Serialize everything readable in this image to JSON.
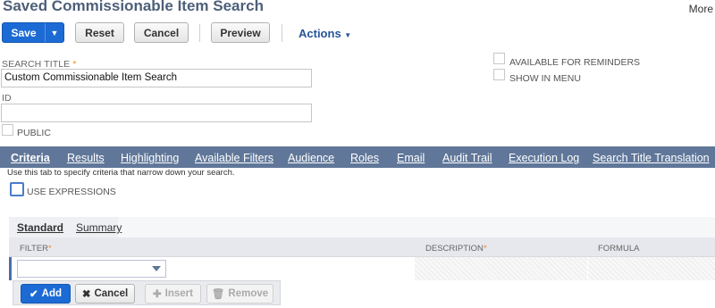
{
  "header": {
    "title": "Saved Commissionable Item Search",
    "more_label": "More"
  },
  "toolbar": {
    "save_label": "Save",
    "reset_label": "Reset",
    "cancel_label": "Cancel",
    "preview_label": "Preview",
    "actions_label": "Actions"
  },
  "form": {
    "search_title_label": "SEARCH TITLE",
    "search_title_value": "Custom Commissionable Item Search",
    "id_label": "ID",
    "id_value": "",
    "public_label": "PUBLIC",
    "available_for_reminders_label": "AVAILABLE FOR REMINDERS",
    "show_in_menu_label": "SHOW IN MENU"
  },
  "tabs": [
    {
      "label": "Criteria",
      "active": true
    },
    {
      "label": "Results"
    },
    {
      "label": "Highlighting"
    },
    {
      "label": "Available Filters"
    },
    {
      "label": "Audience"
    },
    {
      "label": "Roles"
    },
    {
      "label": "Email"
    },
    {
      "label": "Audit Trail"
    },
    {
      "label": "Execution Log"
    },
    {
      "label": "Search Title Translation"
    }
  ],
  "criteria": {
    "help_text": "Use this tab to specify criteria that narrow down your search.",
    "use_expressions_label": "USE EXPRESSIONS",
    "subtabs": [
      {
        "label": "Standard",
        "active": true
      },
      {
        "label": "Summary"
      }
    ],
    "columns": {
      "filter": "FILTER",
      "description": "DESCRIPTION",
      "formula": "FORMULA"
    },
    "buttons": {
      "add": "Add",
      "cancel": "Cancel",
      "insert": "Insert",
      "remove": "Remove"
    }
  },
  "colors": {
    "title": "#4d5f79",
    "primary": "#1c6bd5",
    "tabbar": "#607799",
    "required": "#f28b1b"
  }
}
